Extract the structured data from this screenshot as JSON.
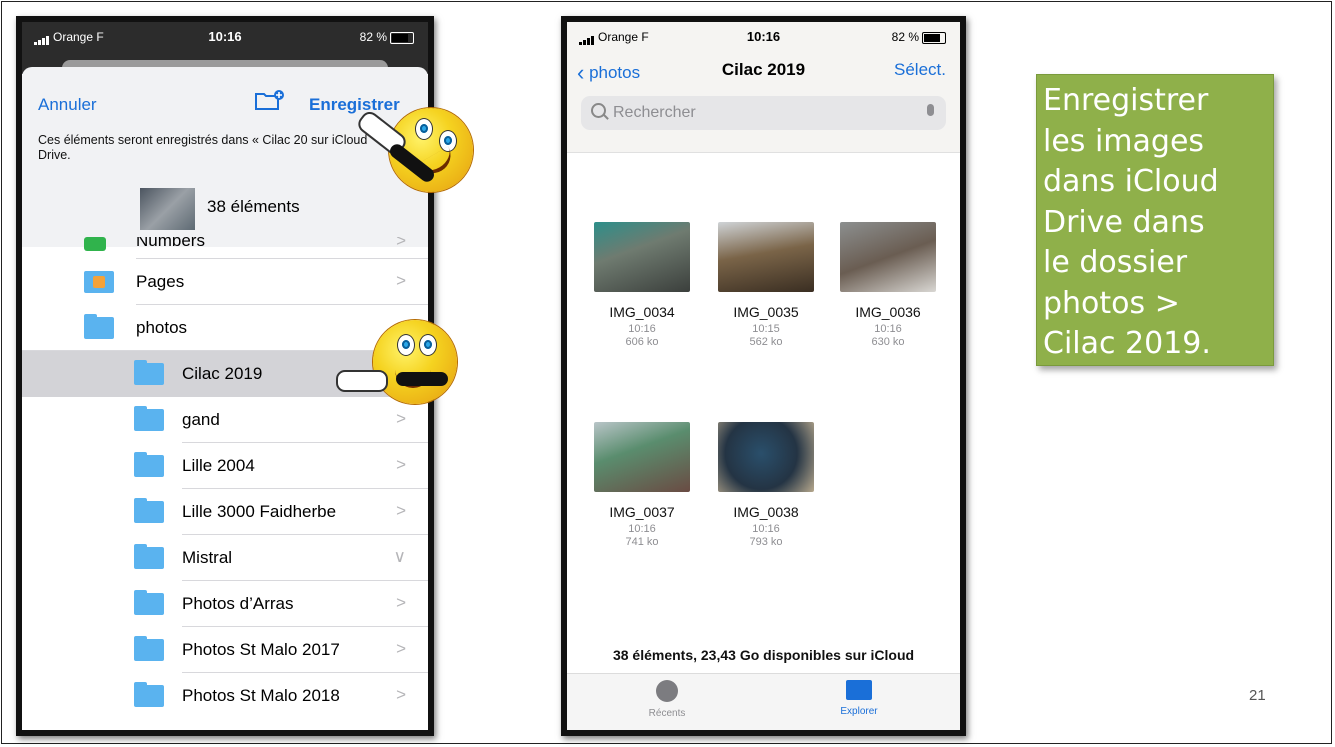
{
  "slide_number": "21",
  "caption": "Enregistrer\nles images\ndans iCloud\nDrive dans\nle dossier\nphotos >\nCilac 2019.",
  "phone1": {
    "status": {
      "carrier": "Orange F",
      "time": "10:16",
      "battery": "82 %"
    },
    "sheet": {
      "cancel": "Annuler",
      "save": "Enregistrer",
      "info": "Ces éléments seront enregistrés dans « Cilac 20 sur iCloud Drive.",
      "count": "38 éléments"
    },
    "folders": [
      {
        "label": "Numbers",
        "icon": "numbers-app-icon"
      },
      {
        "label": "Pages",
        "icon": "pages-app-icon"
      },
      {
        "label": "photos",
        "icon": "folder-icon"
      },
      {
        "label": "Cilac 2019",
        "icon": "folder-icon",
        "selected": true
      },
      {
        "label": "gand",
        "icon": "folder-icon"
      },
      {
        "label": "Lille 2004",
        "icon": "folder-icon"
      },
      {
        "label": "Lille 3000 Faidherbe",
        "icon": "folder-icon"
      },
      {
        "label": "Mistral",
        "icon": "folder-icon",
        "expanded": true
      },
      {
        "label": "Photos d’Arras",
        "icon": "folder-icon"
      },
      {
        "label": "Photos St Malo 2017",
        "icon": "folder-icon"
      },
      {
        "label": "Photos St Malo 2018",
        "icon": "folder-icon"
      }
    ],
    "chevron": ">",
    "chevron_down": "∨"
  },
  "phone2": {
    "status": {
      "carrier": "Orange F",
      "time": "10:16",
      "battery": "82 %"
    },
    "nav": {
      "back": "photos",
      "title": "Cilac 2019",
      "select": "Sélect."
    },
    "search_placeholder": "Rechercher",
    "files": [
      {
        "name": "IMG_0034",
        "time": "10:16",
        "size": "606 ko",
        "color": "#5a6f70"
      },
      {
        "name": "IMG_0035",
        "time": "10:15",
        "size": "562 ko",
        "color": "#6c5a45"
      },
      {
        "name": "IMG_0036",
        "time": "10:16",
        "size": "630 ko",
        "color": "#6f6a66"
      },
      {
        "name": "IMG_0037",
        "time": "10:16",
        "size": "741 ko",
        "color": "#5c6a63"
      },
      {
        "name": "IMG_0038",
        "time": "10:16",
        "size": "793 ko",
        "color": "#3d4a5a"
      }
    ],
    "footer": "38 éléments, 23,43 Go disponibles sur iCloud",
    "tabs": {
      "recents": "Récents",
      "explorer": "Explorer"
    }
  },
  "colors": {
    "ios_blue": "#1a6fd8",
    "folder_blue": "#5ab3ef",
    "caption_green": "#8fb04a"
  }
}
